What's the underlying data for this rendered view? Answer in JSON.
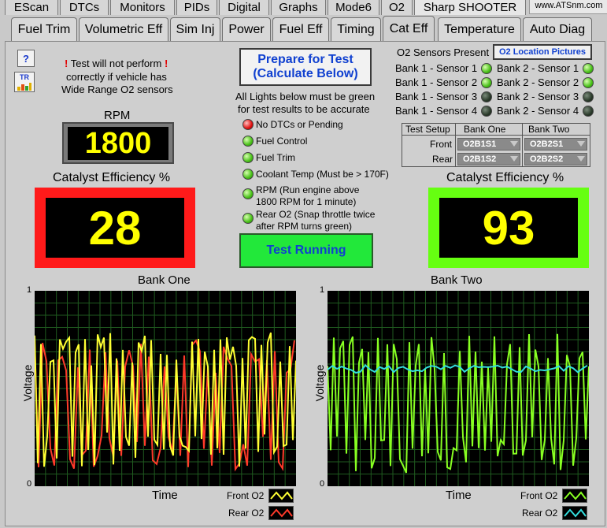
{
  "top_tabs": [
    "EScan",
    "DTCs",
    "Monitors",
    "PIDs",
    "Digital",
    "Graphs",
    "Mode6",
    "O2",
    "Sharp SHOOTER"
  ],
  "brand_url": "www.ATSnm.com",
  "sub_tabs": [
    "Fuel Trim",
    "Volumetric Eff",
    "Sim Inj",
    "Power",
    "Fuel Eff",
    "Timing",
    "Cat Eff",
    "Temperature",
    "Auto Diag"
  ],
  "active_sub_tab": "Cat Eff",
  "help_label": "?",
  "tr_label": "TR",
  "warning": {
    "bang": "!",
    "line1": "Test will not perform",
    "line2": "correctly if vehicle has",
    "line3": "Wide Range O2 sensors"
  },
  "prepare_button": {
    "line1": "Prepare for Test",
    "line2": "(Calculate Below)"
  },
  "requirements_header": {
    "line1": "All Lights below must be green",
    "line2": "for test results to be accurate"
  },
  "requirements": [
    {
      "line1": "No DTCs or Pending",
      "line2": "",
      "status": "red"
    },
    {
      "line1": "Fuel Control",
      "line2": "",
      "status": "green"
    },
    {
      "line1": "Fuel Trim",
      "line2": "",
      "status": "green"
    },
    {
      "line1": "Coolant Temp (Must be > 170F)",
      "line2": "",
      "status": "green"
    },
    {
      "line1": "RPM (Run engine above",
      "line2": "1800 RPM for 1 minute)",
      "status": "green"
    },
    {
      "line1": "Rear O2 (Snap throttle twice",
      "line2": "after RPM turns green)",
      "status": "green"
    }
  ],
  "test_running_label": "Test Running",
  "rpm": {
    "label": "RPM",
    "value": "1800"
  },
  "bank_one_eff": {
    "label": "Catalyst Efficiency %",
    "value": "28",
    "border_color": "#ff1a1a"
  },
  "bank_two_eff": {
    "label": "Catalyst Efficiency %",
    "value": "93",
    "border_color": "#66ff11"
  },
  "o2_present": {
    "label": "O2 Sensors Present",
    "pictures_button": "O2 Location Pictures",
    "bank1": [
      {
        "label": "Bank 1 - Sensor 1",
        "status": "green"
      },
      {
        "label": "Bank 1 - Sensor 2",
        "status": "green"
      },
      {
        "label": "Bank 1 - Sensor 3",
        "status": "dark"
      },
      {
        "label": "Bank 1 - Sensor 4",
        "status": "dark"
      }
    ],
    "bank2": [
      {
        "label": "Bank 2 - Sensor 1",
        "status": "green"
      },
      {
        "label": "Bank 2 - Sensor 2",
        "status": "green"
      },
      {
        "label": "Bank 2 - Sensor 3",
        "status": "dark"
      },
      {
        "label": "Bank 2 - Sensor 4",
        "status": "dark"
      }
    ]
  },
  "test_setup": {
    "header": "Test Setup",
    "col1": "Bank One",
    "col2": "Bank Two",
    "rows": [
      {
        "label": "Front",
        "bank_one": "O2B1S1",
        "bank_two": "O2B2S1"
      },
      {
        "label": "Rear",
        "bank_one": "O2B1S2",
        "bank_two": "O2B2S2"
      }
    ]
  },
  "graph_one": {
    "title": "Bank One",
    "ylabel": "Voltage",
    "xlabel": "Time",
    "y_max_label": "1",
    "y_min_label": "0",
    "legend_front": "Front O2",
    "legend_rear": "Rear O2",
    "front_color": "#ffff33",
    "rear_color": "#ff3a2a"
  },
  "graph_two": {
    "title": "Bank Two",
    "ylabel": "Voltage",
    "xlabel": "Time",
    "y_max_label": "1",
    "y_min_label": "0",
    "legend_front": "Front O2",
    "legend_rear": "Rear O2",
    "front_color": "#88ff22",
    "rear_color": "#33dddd"
  }
}
